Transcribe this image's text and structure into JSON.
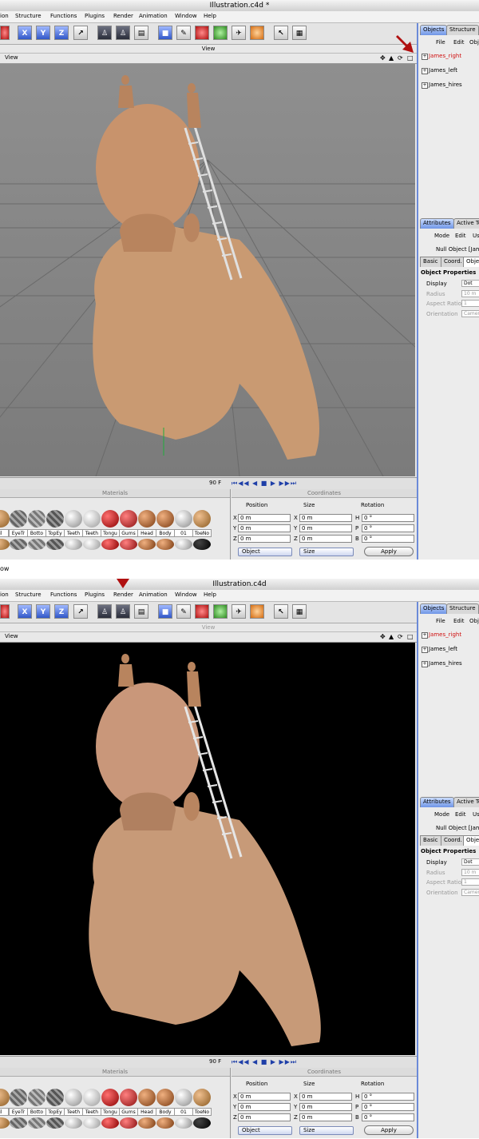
{
  "screens": [
    {
      "title": "Illustration.c4d *",
      "viewport_background": "grey-grid",
      "arrow_target": "objects-panel-first-row"
    },
    {
      "title": "Illustration.c4d",
      "viewport_background": "black-render",
      "arrow_target": "render-menu"
    }
  ],
  "menu": [
    "ion",
    "Structure",
    "Functions",
    "Plugins",
    "Render",
    "Animation",
    "Window",
    "Help"
  ],
  "toolbar": {
    "buttons": [
      "X",
      "Y",
      "Z"
    ]
  },
  "view": {
    "title": "View",
    "header_label": "View"
  },
  "timeline": {
    "frame": "90 F",
    "transport_glyphs": "⏮◀◀ ◀ ■ ▶ ▶▶⏭"
  },
  "materials": {
    "title": "Materials",
    "row1": [
      "oil",
      "EyeTr",
      "Botto",
      "TopEy",
      "Teeth",
      "Teeth",
      "Tongu",
      "Gums",
      "Head",
      "Body",
      "01",
      "ToeNo"
    ]
  },
  "coordinates": {
    "title": "Coordinates",
    "col_position": "Position",
    "col_size": "Size",
    "col_rotation": "Rotation",
    "rows": [
      {
        "axis": "X",
        "pos": "0 m",
        "size_axis": "X",
        "size": "0 m",
        "rot_axis": "H",
        "rot": "0 °"
      },
      {
        "axis": "Y",
        "pos": "0 m",
        "size_axis": "Y",
        "size": "0 m",
        "rot_axis": "P",
        "rot": "0 °"
      },
      {
        "axis": "Z",
        "pos": "0 m",
        "size_axis": "Z",
        "size": "0 m",
        "rot_axis": "B",
        "rot": "0 °"
      }
    ],
    "mode_select": "Object",
    "size_select": "Size",
    "apply": "Apply"
  },
  "objects_panel": {
    "tab_objects": "Objects",
    "tab_structure": "Structure",
    "menu_file": "File",
    "menu_edit": "Edit",
    "menu_obj": "Obj",
    "items": [
      "James_right",
      "James_left",
      "James_hires"
    ]
  },
  "attributes_panel": {
    "tab_attributes": "Attributes",
    "tab_active": "Active To",
    "menu_mode": "Mode",
    "menu_edit": "Edit",
    "menu_us": "Us",
    "object_name": "Null Object [Jam",
    "subtab_basic": "Basic",
    "subtab_coord": "Coord.",
    "subtab_object": "Objec",
    "section": "Object Properties",
    "props": [
      {
        "label": "Display",
        "value": "Dot",
        "enabled": true
      },
      {
        "label": "Radius",
        "value": "10 m",
        "enabled": false
      },
      {
        "label": "Aspect Ratio",
        "value": "1",
        "enabled": false
      },
      {
        "label": "Orientation",
        "value": "Camera",
        "enabled": false
      }
    ]
  },
  "gap_text": "ow",
  "colors": {
    "accent_blue": "#6b8ad8",
    "selected_red": "#d01010",
    "arrow_red": "#b01010"
  }
}
